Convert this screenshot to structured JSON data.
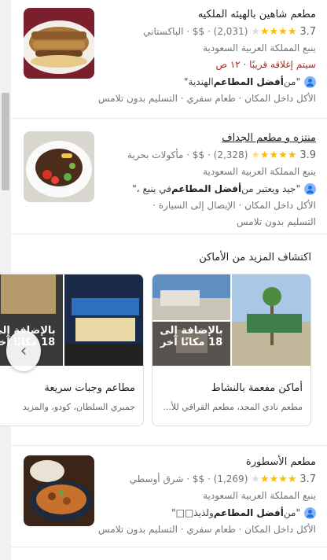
{
  "restaurants": [
    {
      "name": "مطعم شاهين بالهيئه الملكيه",
      "rating": "3.7",
      "stars_full": "★★★★",
      "stars_empty": "★",
      "reviews": "(2,031)",
      "price": "$$",
      "category": "الباكستاني",
      "location": "ينبع المملكة العربية السعودية",
      "status": "سيتم إغلاقه قريبًا ⋅ ١٢ ص",
      "review_prefix": "\"من ",
      "review_bold": "أفضل المطاعم",
      "review_suffix": " الهندية\"",
      "services": "الأكل داخل المكان · طعام سفري · التسليم بدون تلامس"
    },
    {
      "name": "منتزه و مطعم الجداف",
      "rating": "3.9",
      "stars_full": "★★★★",
      "stars_empty": "",
      "reviews": "(2,328)",
      "price": "$$",
      "category": "مأكولات بحرية",
      "location": "ينبع المملكة العربية السعودية",
      "review_prefix": "\"جيد ويعتبر من ",
      "review_bold": "أفضل المطاعم",
      "review_suffix": " في ينبع ،\"",
      "services_line1": "الأكل داخل المكان · الإيصال إلى السيارة ·",
      "services_line2": "التسليم بدون تلامس"
    },
    {
      "name": "مطعم الأسطورة",
      "rating": "3.7",
      "stars_full": "★★★★",
      "stars_empty": "★",
      "reviews": "(1,269)",
      "price": "$$",
      "category": "شرق أوسطي",
      "location": "ينبع المملكة العربية السعودية",
      "review_prefix": "\"من ",
      "review_bold": "أفضل المطاعم",
      "review_suffix": " ولذيذ□□\"",
      "services": "الأكل داخل المكان · طعام سفري · التسليم بدون تلامس"
    }
  ],
  "explore": {
    "title": "اكتشاف المزيد من الأماكن",
    "cards": [
      {
        "title": "أماكن مفعمة بالنشاط",
        "subtitle": "مطعم نادي المجد، مطعم القراقي للأ...",
        "overlay": "بالإضافة إلى 18 مكانًا آخر"
      },
      {
        "title": "مطاعم وجبات سريعة",
        "subtitle": "جمبري السلطان، كودو، والمزيد",
        "overlay": "بالإضافة إلى 18 مكانًا آخر"
      }
    ]
  },
  "icons": {
    "carousel_prev": "chevron-left-icon",
    "reviewer_avatar": "person-avatar-icon"
  },
  "colors": {
    "star": "#fbbc04",
    "closing": "#b3261e",
    "link_blue": "#1a73e8"
  }
}
